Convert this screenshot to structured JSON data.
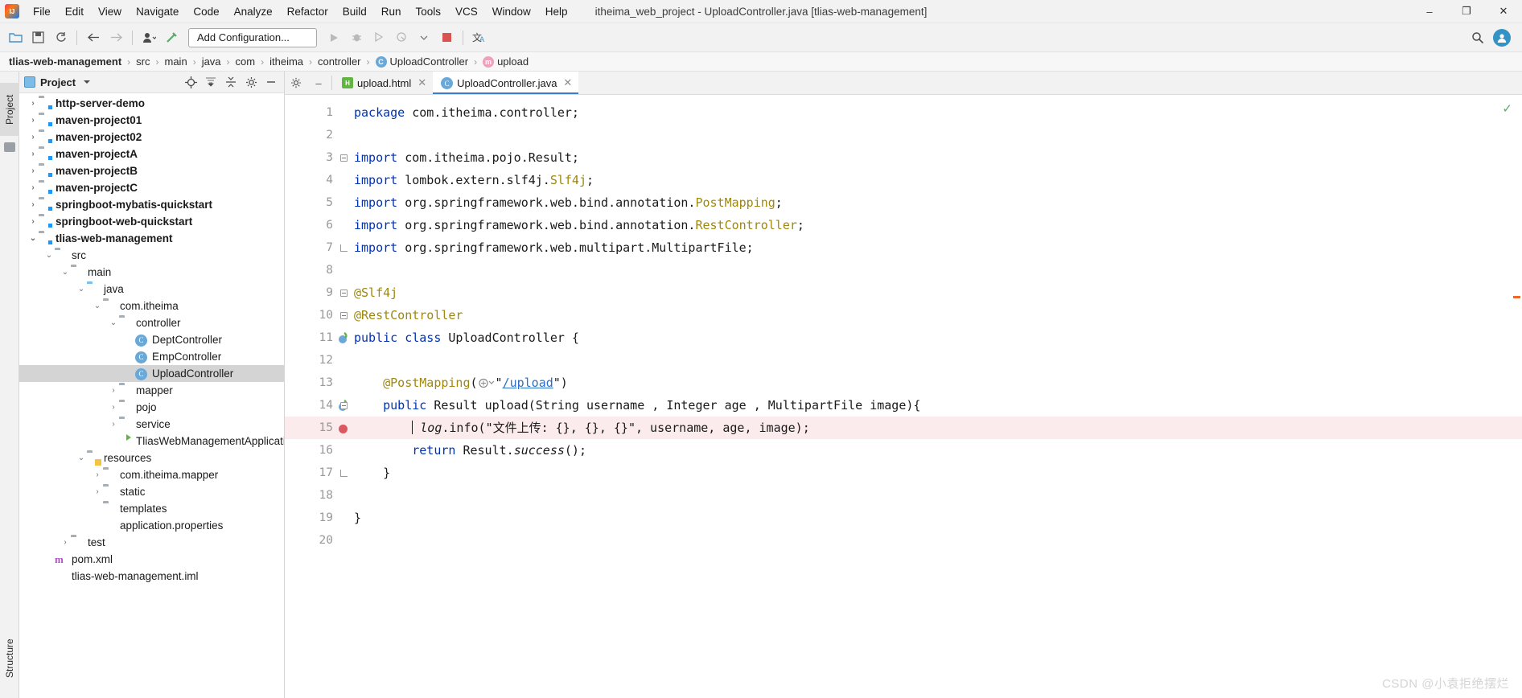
{
  "window": {
    "title": "itheima_web_project - UploadController.java [tlias-web-management]",
    "minimize": "–",
    "maximize": "❐",
    "close": "✕"
  },
  "menu": [
    {
      "label": "File"
    },
    {
      "label": "Edit"
    },
    {
      "label": "View"
    },
    {
      "label": "Navigate"
    },
    {
      "label": "Code"
    },
    {
      "label": "Analyze"
    },
    {
      "label": "Refactor"
    },
    {
      "label": "Build"
    },
    {
      "label": "Run"
    },
    {
      "label": "Tools"
    },
    {
      "label": "VCS"
    },
    {
      "label": "Window"
    },
    {
      "label": "Help"
    }
  ],
  "toolbar": {
    "open_icon": "open-folder-icon",
    "save_icon": "save-icon",
    "sync_icon": "sync-icon",
    "back_icon": "←",
    "forward_icon": "→",
    "profile_icon": "user-icon",
    "build_icon": "build-hammer-icon",
    "add_configuration": "Add Configuration...",
    "run_icon": "▶",
    "debug_icon": "debug-icon",
    "coverage_icon": "run-coverage-icon",
    "profiler_icon": "profiler-icon",
    "stop_icon": "stop-icon",
    "translate_icon": "translate-icon",
    "search_icon": "⌕",
    "account_icon": "account-icon",
    "accent": "#3592c4"
  },
  "breadcrumb": [
    {
      "label": "tlias-web-management",
      "bold": true,
      "icon": null
    },
    {
      "label": "src",
      "bold": false,
      "icon": null
    },
    {
      "label": "main",
      "bold": false,
      "icon": null
    },
    {
      "label": "java",
      "bold": false,
      "icon": null
    },
    {
      "label": "com",
      "bold": false,
      "icon": null
    },
    {
      "label": "itheima",
      "bold": false,
      "icon": null
    },
    {
      "label": "controller",
      "bold": false,
      "icon": null
    },
    {
      "label": "UploadController",
      "bold": false,
      "icon": "class-badge",
      "badge": "C"
    },
    {
      "label": "upload",
      "bold": false,
      "icon": "method-badge",
      "badge": "m"
    }
  ],
  "separator": "›",
  "left_strip": {
    "project_tab": "Project",
    "structure_tab": "Structure"
  },
  "project_panel": {
    "title": "Project",
    "dropdown_icon": "chevron-down-icon",
    "locate_icon": "locate-file-icon",
    "expand_icon": "expand-all-icon",
    "collapse_icon": "collapse-all-icon",
    "settings_icon": "gear-icon",
    "hide_icon": "hide-panel-icon",
    "nodes": [
      {
        "label": "http-server-demo",
        "depth": 0,
        "arrow": "›",
        "icon": "module",
        "bold": true,
        "selected": false
      },
      {
        "label": "maven-project01",
        "depth": 0,
        "arrow": "›",
        "icon": "module",
        "bold": true,
        "selected": false
      },
      {
        "label": "maven-project02",
        "depth": 0,
        "arrow": "›",
        "icon": "module",
        "bold": true,
        "selected": false
      },
      {
        "label": "maven-projectA",
        "depth": 0,
        "arrow": "›",
        "icon": "module",
        "bold": true,
        "selected": false
      },
      {
        "label": "maven-projectB",
        "depth": 0,
        "arrow": "›",
        "icon": "module",
        "bold": true,
        "selected": false
      },
      {
        "label": "maven-projectC",
        "depth": 0,
        "arrow": "›",
        "icon": "module",
        "bold": true,
        "selected": false
      },
      {
        "label": "springboot-mybatis-quickstart",
        "depth": 0,
        "arrow": "›",
        "icon": "module",
        "bold": true,
        "selected": false
      },
      {
        "label": "springboot-web-quickstart",
        "depth": 0,
        "arrow": "›",
        "icon": "module",
        "bold": true,
        "selected": false
      },
      {
        "label": "tlias-web-management",
        "depth": 0,
        "arrow": "⌄",
        "icon": "module",
        "bold": true,
        "selected": false
      },
      {
        "label": "src",
        "depth": 1,
        "arrow": "⌄",
        "icon": "folder",
        "bold": false,
        "selected": false
      },
      {
        "label": "main",
        "depth": 2,
        "arrow": "⌄",
        "icon": "folder",
        "bold": false,
        "selected": false
      },
      {
        "label": "java",
        "depth": 3,
        "arrow": "⌄",
        "icon": "folder-blue",
        "bold": false,
        "selected": false
      },
      {
        "label": "com.itheima",
        "depth": 4,
        "arrow": "⌄",
        "icon": "package",
        "bold": false,
        "selected": false
      },
      {
        "label": "controller",
        "depth": 5,
        "arrow": "⌄",
        "icon": "package",
        "bold": false,
        "selected": false
      },
      {
        "label": "DeptController",
        "depth": 6,
        "arrow": "",
        "icon": "class",
        "bold": false,
        "selected": false
      },
      {
        "label": "EmpController",
        "depth": 6,
        "arrow": "",
        "icon": "class",
        "bold": false,
        "selected": false
      },
      {
        "label": "UploadController",
        "depth": 6,
        "arrow": "",
        "icon": "class",
        "bold": false,
        "selected": true
      },
      {
        "label": "mapper",
        "depth": 5,
        "arrow": "›",
        "icon": "package",
        "bold": false,
        "selected": false
      },
      {
        "label": "pojo",
        "depth": 5,
        "arrow": "›",
        "icon": "package",
        "bold": false,
        "selected": false
      },
      {
        "label": "service",
        "depth": 5,
        "arrow": "›",
        "icon": "package",
        "bold": false,
        "selected": false
      },
      {
        "label": "TliasWebManagementApplication",
        "depth": 5,
        "arrow": "",
        "icon": "spring",
        "bold": false,
        "selected": false
      },
      {
        "label": "resources",
        "depth": 3,
        "arrow": "⌄",
        "icon": "resources",
        "bold": false,
        "selected": false
      },
      {
        "label": "com.itheima.mapper",
        "depth": 4,
        "arrow": "›",
        "icon": "folder",
        "bold": false,
        "selected": false
      },
      {
        "label": "static",
        "depth": 4,
        "arrow": "›",
        "icon": "folder",
        "bold": false,
        "selected": false
      },
      {
        "label": "templates",
        "depth": 4,
        "arrow": "",
        "icon": "folder",
        "bold": false,
        "selected": false
      },
      {
        "label": "application.properties",
        "depth": 4,
        "arrow": "",
        "icon": "properties",
        "bold": false,
        "selected": false
      },
      {
        "label": "test",
        "depth": 2,
        "arrow": "›",
        "icon": "folder",
        "bold": false,
        "selected": false
      },
      {
        "label": "pom.xml",
        "depth": 1,
        "arrow": "",
        "icon": "maven",
        "bold": false,
        "selected": false
      },
      {
        "label": "tlias-web-management.iml",
        "depth": 1,
        "arrow": "",
        "icon": "iml",
        "bold": false,
        "selected": false
      }
    ]
  },
  "editor": {
    "tabs": [
      {
        "label": "upload.html",
        "icon": "html-file-icon",
        "active": false,
        "close": "✕"
      },
      {
        "label": "UploadController.java",
        "icon": "java-class-icon",
        "active": true,
        "close": "✕"
      }
    ],
    "gear_icon": "gear-icon",
    "minimize_icon": "–",
    "inspection_ok_icon": "✓",
    "highlighted_line": 15,
    "lines": [
      {
        "n": 1,
        "fold": "",
        "gutter_icon": "",
        "tokens": [
          {
            "t": "package",
            "c": "kw"
          },
          {
            "t": " com.itheima.controller;",
            "c": "plain"
          }
        ]
      },
      {
        "n": 2,
        "fold": "",
        "gutter_icon": "",
        "tokens": []
      },
      {
        "n": 3,
        "fold": "start",
        "gutter_icon": "",
        "tokens": [
          {
            "t": "import",
            "c": "kw"
          },
          {
            "t": " com.itheima.pojo.Result;",
            "c": "plain"
          }
        ]
      },
      {
        "n": 4,
        "fold": "",
        "gutter_icon": "",
        "tokens": [
          {
            "t": "import",
            "c": "kw"
          },
          {
            "t": " lombok.extern.slf4j.",
            "c": "plain"
          },
          {
            "t": "Slf4j",
            "c": "ann"
          },
          {
            "t": ";",
            "c": "plain"
          }
        ]
      },
      {
        "n": 5,
        "fold": "",
        "gutter_icon": "",
        "tokens": [
          {
            "t": "import",
            "c": "kw"
          },
          {
            "t": " org.springframework.web.bind.annotation.",
            "c": "plain"
          },
          {
            "t": "PostMapping",
            "c": "ann"
          },
          {
            "t": ";",
            "c": "plain"
          }
        ]
      },
      {
        "n": 6,
        "fold": "",
        "gutter_icon": "",
        "tokens": [
          {
            "t": "import",
            "c": "kw"
          },
          {
            "t": " org.springframework.web.bind.annotation.",
            "c": "plain"
          },
          {
            "t": "RestController",
            "c": "ann"
          },
          {
            "t": ";",
            "c": "plain"
          }
        ]
      },
      {
        "n": 7,
        "fold": "end",
        "gutter_icon": "",
        "tokens": [
          {
            "t": "import",
            "c": "kw"
          },
          {
            "t": " org.springframework.web.multipart.MultipartFile;",
            "c": "plain"
          }
        ]
      },
      {
        "n": 8,
        "fold": "",
        "gutter_icon": "",
        "tokens": []
      },
      {
        "n": 9,
        "fold": "start",
        "gutter_icon": "",
        "tokens": [
          {
            "t": "@Slf4j",
            "c": "ann"
          }
        ]
      },
      {
        "n": 10,
        "fold": "start",
        "gutter_icon": "",
        "tokens": [
          {
            "t": "@RestController",
            "c": "ann"
          }
        ]
      },
      {
        "n": 11,
        "fold": "",
        "gutter_icon": "spring-bean-icon",
        "tokens": [
          {
            "t": "public",
            "c": "kw"
          },
          {
            "t": " ",
            "c": "plain"
          },
          {
            "t": "class",
            "c": "kw"
          },
          {
            "t": " UploadController {",
            "c": "plain"
          }
        ]
      },
      {
        "n": 12,
        "fold": "",
        "gutter_icon": "",
        "tokens": []
      },
      {
        "n": 13,
        "fold": "",
        "gutter_icon": "",
        "tokens": [
          {
            "t": "    ",
            "c": "plain"
          },
          {
            "t": "@PostMapping",
            "c": "ann"
          },
          {
            "t": "(",
            "c": "plain"
          },
          {
            "t": "GUTTER_URL",
            "c": "urlicon"
          },
          {
            "t": "\"",
            "c": "plain"
          },
          {
            "t": "/upload",
            "c": "link"
          },
          {
            "t": "\")",
            "c": "plain"
          }
        ]
      },
      {
        "n": 14,
        "fold": "start",
        "gutter_icon": "spring-request-icon",
        "tokens": [
          {
            "t": "    ",
            "c": "plain"
          },
          {
            "t": "public",
            "c": "kw"
          },
          {
            "t": " Result ",
            "c": "plain"
          },
          {
            "t": "upload",
            "c": "plain"
          },
          {
            "t": "(String username , Integer age , MultipartFile image){",
            "c": "plain"
          }
        ]
      },
      {
        "n": 15,
        "fold": "",
        "gutter_icon": "breakpoint-icon",
        "tokens": [
          {
            "t": "        ",
            "c": "plain"
          },
          {
            "t": "CARET",
            "c": "caret"
          },
          {
            "t": "log",
            "c": "fld"
          },
          {
            "t": ".info(",
            "c": "plain"
          },
          {
            "t": "\"文件上传: {}, {}, {}\"",
            "c": "str"
          },
          {
            "t": ", username, age, image);",
            "c": "plain"
          }
        ]
      },
      {
        "n": 16,
        "fold": "",
        "gutter_icon": "",
        "tokens": [
          {
            "t": "        ",
            "c": "plain"
          },
          {
            "t": "return",
            "c": "kw"
          },
          {
            "t": " Result.",
            "c": "plain"
          },
          {
            "t": "success",
            "c": "fld"
          },
          {
            "t": "();",
            "c": "plain"
          }
        ]
      },
      {
        "n": 17,
        "fold": "end",
        "gutter_icon": "",
        "tokens": [
          {
            "t": "    }",
            "c": "plain"
          }
        ]
      },
      {
        "n": 18,
        "fold": "",
        "gutter_icon": "",
        "tokens": []
      },
      {
        "n": 19,
        "fold": "",
        "gutter_icon": "",
        "tokens": [
          {
            "t": "}",
            "c": "plain"
          }
        ]
      },
      {
        "n": 20,
        "fold": "",
        "gutter_icon": "",
        "tokens": []
      }
    ]
  },
  "watermark": "CSDN @小袁拒绝摆烂"
}
